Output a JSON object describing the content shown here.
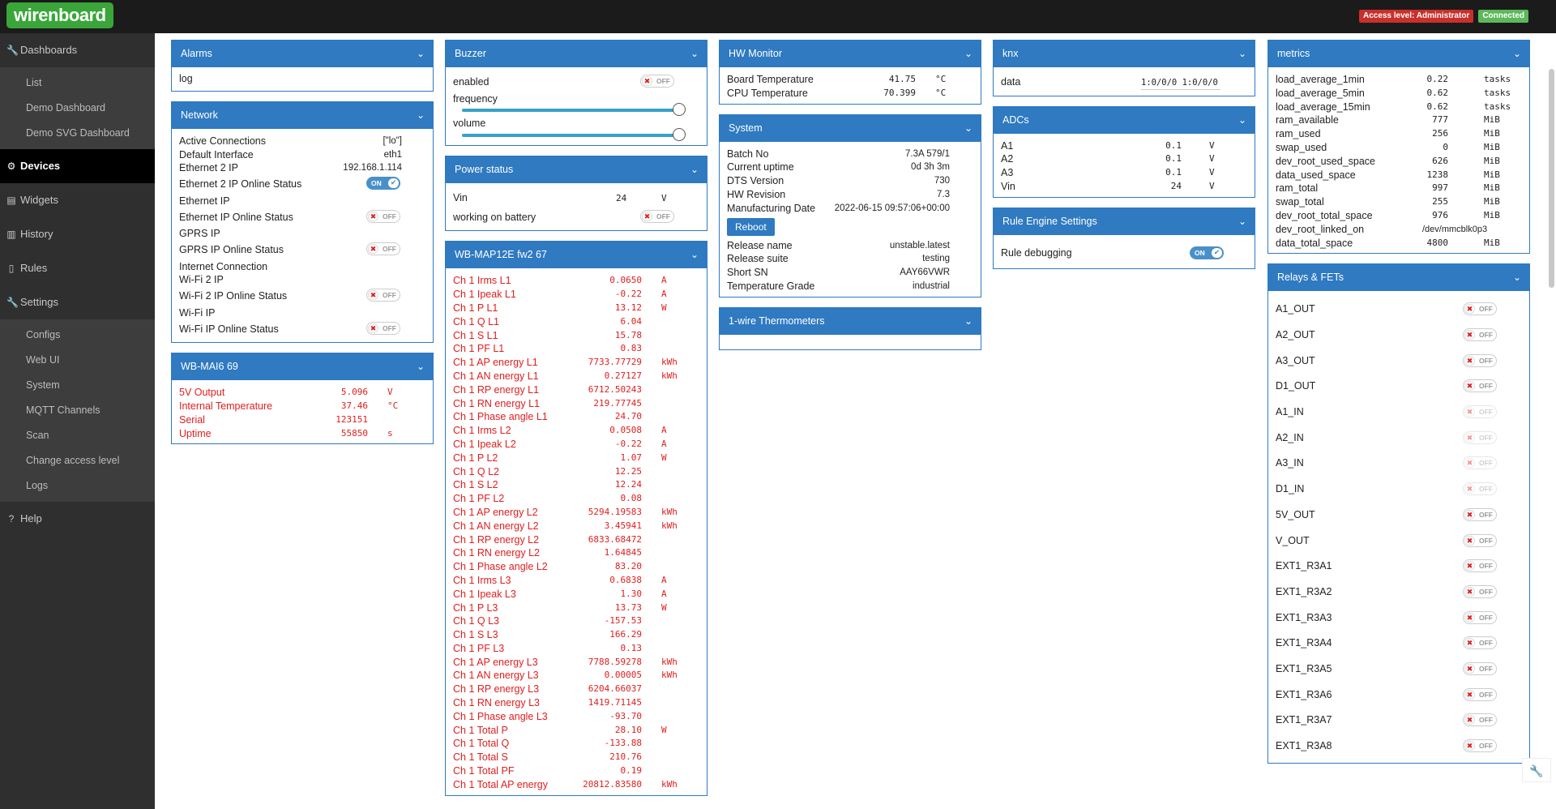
{
  "app": {
    "logo": "wirenboard",
    "access_badge": "Access level: Administrator",
    "connection_badge": "Connected"
  },
  "sidebar": {
    "dashboards": "Dashboards",
    "list": "List",
    "demo_dashboard": "Demo Dashboard",
    "demo_svg": "Demo SVG Dashboard",
    "devices": "Devices",
    "widgets": "Widgets",
    "history": "History",
    "rules": "Rules",
    "settings": "Settings",
    "configs": "Configs",
    "webui": "Web UI",
    "system": "System",
    "mqtt": "MQTT Channels",
    "scan": "Scan",
    "access": "Change access level",
    "logs": "Logs",
    "help": "Help"
  },
  "alarms": {
    "title": "Alarms",
    "log": "log"
  },
  "network": {
    "title": "Network",
    "rows": [
      {
        "label": "Active Connections",
        "value": "[\"lo\"]"
      },
      {
        "label": "Default Interface",
        "value": "eth1"
      },
      {
        "label": "Ethernet 2 IP",
        "value": "192.168.1.114"
      },
      {
        "label": "Ethernet 2 IP Online Status",
        "toggle": "ON"
      },
      {
        "label": "Ethernet IP"
      },
      {
        "label": "Ethernet IP Online Status",
        "toggle": "OFF"
      },
      {
        "label": "GPRS IP"
      },
      {
        "label": "GPRS IP Online Status",
        "toggle": "OFF"
      },
      {
        "label": "Internet Connection"
      },
      {
        "label": "Wi-Fi 2 IP"
      },
      {
        "label": "Wi-Fi 2 IP Online Status",
        "toggle": "OFF"
      },
      {
        "label": "Wi-Fi IP"
      },
      {
        "label": "Wi-Fi IP Online Status",
        "toggle": "OFF"
      }
    ]
  },
  "mai6": {
    "title": "WB-MAI6 69",
    "rows": [
      {
        "label": "5V Output",
        "value": "5.096",
        "unit": "V"
      },
      {
        "label": "Internal Temperature",
        "value": "37.46",
        "unit": "°C"
      },
      {
        "label": "Serial",
        "value": "123151",
        "unit": ""
      },
      {
        "label": "Uptime",
        "value": "55850",
        "unit": "s"
      }
    ]
  },
  "buzzer": {
    "title": "Buzzer",
    "enabled": "enabled",
    "enabled_toggle": "OFF",
    "frequency": "frequency",
    "volume": "volume"
  },
  "power": {
    "title": "Power status",
    "vin_label": "Vin",
    "vin_value": "24",
    "vin_unit": "V",
    "battery": "working on battery",
    "battery_toggle": "OFF"
  },
  "map12e": {
    "title": "WB-MAP12E fw2 67",
    "rows": [
      [
        "Ch 1 Irms L1",
        "0.0650",
        "A"
      ],
      [
        "Ch 1 Ipeak L1",
        "-0.22",
        "A"
      ],
      [
        "Ch 1 P L1",
        "13.12",
        "W"
      ],
      [
        "Ch 1 Q L1",
        "6.04",
        ""
      ],
      [
        "Ch 1 S L1",
        "15.78",
        ""
      ],
      [
        "Ch 1 PF L1",
        "0.83",
        ""
      ],
      [
        "Ch 1 AP energy L1",
        "7733.77729",
        "kWh"
      ],
      [
        "Ch 1 AN energy L1",
        "0.27127",
        "kWh"
      ],
      [
        "Ch 1 RP energy L1",
        "6712.50243",
        ""
      ],
      [
        "Ch 1 RN energy L1",
        "219.77745",
        ""
      ],
      [
        "Ch 1 Phase angle L1",
        "24.70",
        ""
      ],
      [
        "Ch 1 Irms L2",
        "0.0508",
        "A"
      ],
      [
        "Ch 1 Ipeak L2",
        "-0.22",
        "A"
      ],
      [
        "Ch 1 P L2",
        "1.07",
        "W"
      ],
      [
        "Ch 1 Q L2",
        "12.25",
        ""
      ],
      [
        "Ch 1 S L2",
        "12.24",
        ""
      ],
      [
        "Ch 1 PF L2",
        "0.08",
        ""
      ],
      [
        "Ch 1 AP energy L2",
        "5294.19583",
        "kWh"
      ],
      [
        "Ch 1 AN energy L2",
        "3.45941",
        "kWh"
      ],
      [
        "Ch 1 RP energy L2",
        "6833.68472",
        ""
      ],
      [
        "Ch 1 RN energy L2",
        "1.64845",
        ""
      ],
      [
        "Ch 1 Phase angle L2",
        "83.20",
        ""
      ],
      [
        "Ch 1 Irms L3",
        "0.6838",
        "A"
      ],
      [
        "Ch 1 Ipeak L3",
        "1.30",
        "A"
      ],
      [
        "Ch 1 P L3",
        "13.73",
        "W"
      ],
      [
        "Ch 1 Q L3",
        "-157.53",
        ""
      ],
      [
        "Ch 1 S L3",
        "166.29",
        ""
      ],
      [
        "Ch 1 PF L3",
        "0.13",
        ""
      ],
      [
        "Ch 1 AP energy L3",
        "7788.59278",
        "kWh"
      ],
      [
        "Ch 1 AN energy L3",
        "0.00005",
        "kWh"
      ],
      [
        "Ch 1 RP energy L3",
        "6204.66037",
        ""
      ],
      [
        "Ch 1 RN energy L3",
        "1419.71145",
        ""
      ],
      [
        "Ch 1 Phase angle L3",
        "-93.70",
        ""
      ],
      [
        "Ch 1 Total P",
        "28.10",
        "W"
      ],
      [
        "Ch 1 Total Q",
        "-133.88",
        ""
      ],
      [
        "Ch 1 Total S",
        "210.76",
        ""
      ],
      [
        "Ch 1 Total PF",
        "0.19",
        ""
      ],
      [
        "Ch 1 Total AP energy",
        "20812.83580",
        "kWh"
      ]
    ]
  },
  "hw": {
    "title": "HW Monitor",
    "rows": [
      {
        "label": "Board Temperature",
        "value": "41.75",
        "unit": "°C"
      },
      {
        "label": "CPU Temperature",
        "value": "70.399",
        "unit": "°C"
      }
    ]
  },
  "system": {
    "title": "System",
    "rows": [
      [
        "Batch No",
        "7.3A 579/1"
      ],
      [
        "Current uptime",
        "0d 3h 3m"
      ],
      [
        "DTS Version",
        "730"
      ],
      [
        "HW Revision",
        "7.3"
      ],
      [
        "Manufacturing Date",
        "2022-06-15 09:57:06+00:00"
      ]
    ],
    "reboot": "Reboot",
    "rows2": [
      [
        "Release name",
        "unstable.latest"
      ],
      [
        "Release suite",
        "testing"
      ],
      [
        "Short SN",
        "AAY66VWR"
      ],
      [
        "Temperature Grade",
        "industrial"
      ]
    ]
  },
  "onewire": {
    "title": "1-wire Thermometers"
  },
  "knx": {
    "title": "knx",
    "label": "data",
    "value": "1:0/0/0 1:0/0/0"
  },
  "adcs": {
    "title": "ADCs",
    "rows": [
      {
        "label": "A1",
        "value": "0.1",
        "unit": "V"
      },
      {
        "label": "A2",
        "value": "0.1",
        "unit": "V"
      },
      {
        "label": "A3",
        "value": "0.1",
        "unit": "V"
      },
      {
        "label": "Vin",
        "value": "24",
        "unit": "V"
      }
    ]
  },
  "rule": {
    "title": "Rule Engine Settings",
    "label": "Rule debugging",
    "toggle": "ON"
  },
  "metrics": {
    "title": "metrics",
    "rows": [
      [
        "load_average_1min",
        "0.22",
        "tasks"
      ],
      [
        "load_average_5min",
        "0.62",
        "tasks"
      ],
      [
        "load_average_15min",
        "0.62",
        "tasks"
      ],
      [
        "ram_available",
        "777",
        "MiB"
      ],
      [
        "ram_used",
        "256",
        "MiB"
      ],
      [
        "swap_used",
        "0",
        "MiB"
      ],
      [
        "dev_root_used_space",
        "626",
        "MiB"
      ],
      [
        "data_used_space",
        "1238",
        "MiB"
      ],
      [
        "ram_total",
        "997",
        "MiB"
      ],
      [
        "swap_total",
        "255",
        "MiB"
      ],
      [
        "dev_root_total_space",
        "976",
        "MiB"
      ],
      [
        "dev_root_linked_on",
        "/dev/mmcblk0p3",
        ""
      ],
      [
        "data_total_space",
        "4800",
        "MiB"
      ]
    ]
  },
  "relays": {
    "title": "Relays & FETs",
    "rows": [
      "A1_OUT",
      "A2_OUT",
      "A3_OUT",
      "D1_OUT",
      "A1_IN",
      "A2_IN",
      "A3_IN",
      "D1_IN",
      "5V_OUT",
      "V_OUT",
      "EXT1_R3A1",
      "EXT1_R3A2",
      "EXT1_R3A3",
      "EXT1_R3A4",
      "EXT1_R3A5",
      "EXT1_R3A6",
      "EXT1_R3A7",
      "EXT1_R3A8"
    ],
    "toggle": "OFF"
  },
  "colors": {
    "accent": "#2f7ac1",
    "sidebar": "#2f2f2f",
    "red_text": "#e01e1e"
  }
}
